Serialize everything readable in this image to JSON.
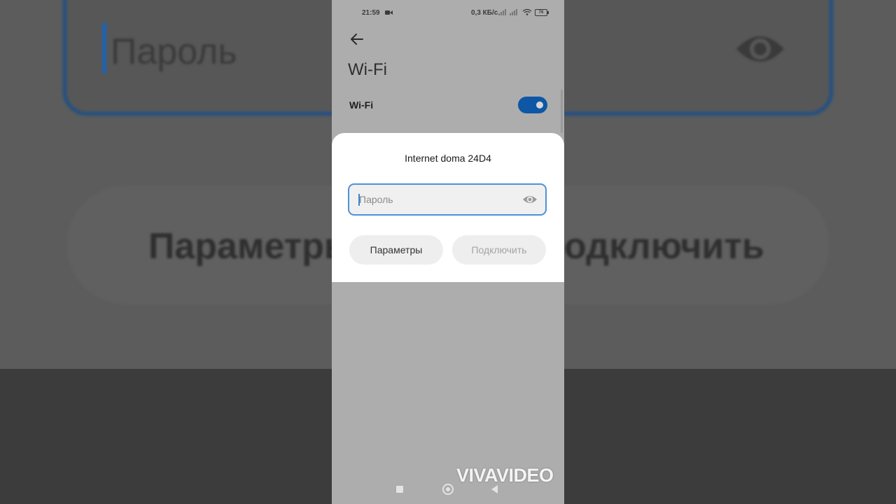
{
  "background": {
    "field_placeholder": "Пароль",
    "btn_left": "Параметры",
    "btn_right": "одключить"
  },
  "status_bar": {
    "time": "21:59",
    "net_speed": "0,3 КБ/с",
    "battery": "76"
  },
  "screen": {
    "title": "Wi-Fi",
    "wifi_label": "Wi-Fi",
    "wifi_enabled": true
  },
  "dialog": {
    "title": "Internet doma 24D4",
    "password_placeholder": "Пароль",
    "password_value": "",
    "params_button": "Параметры",
    "connect_button": "Подключить"
  },
  "watermark": "VIVAVIDEO",
  "icons": {
    "back": "arrow-left-icon",
    "eye": "eye-icon",
    "camera": "video-camera-icon",
    "wifi": "wifi-icon"
  }
}
